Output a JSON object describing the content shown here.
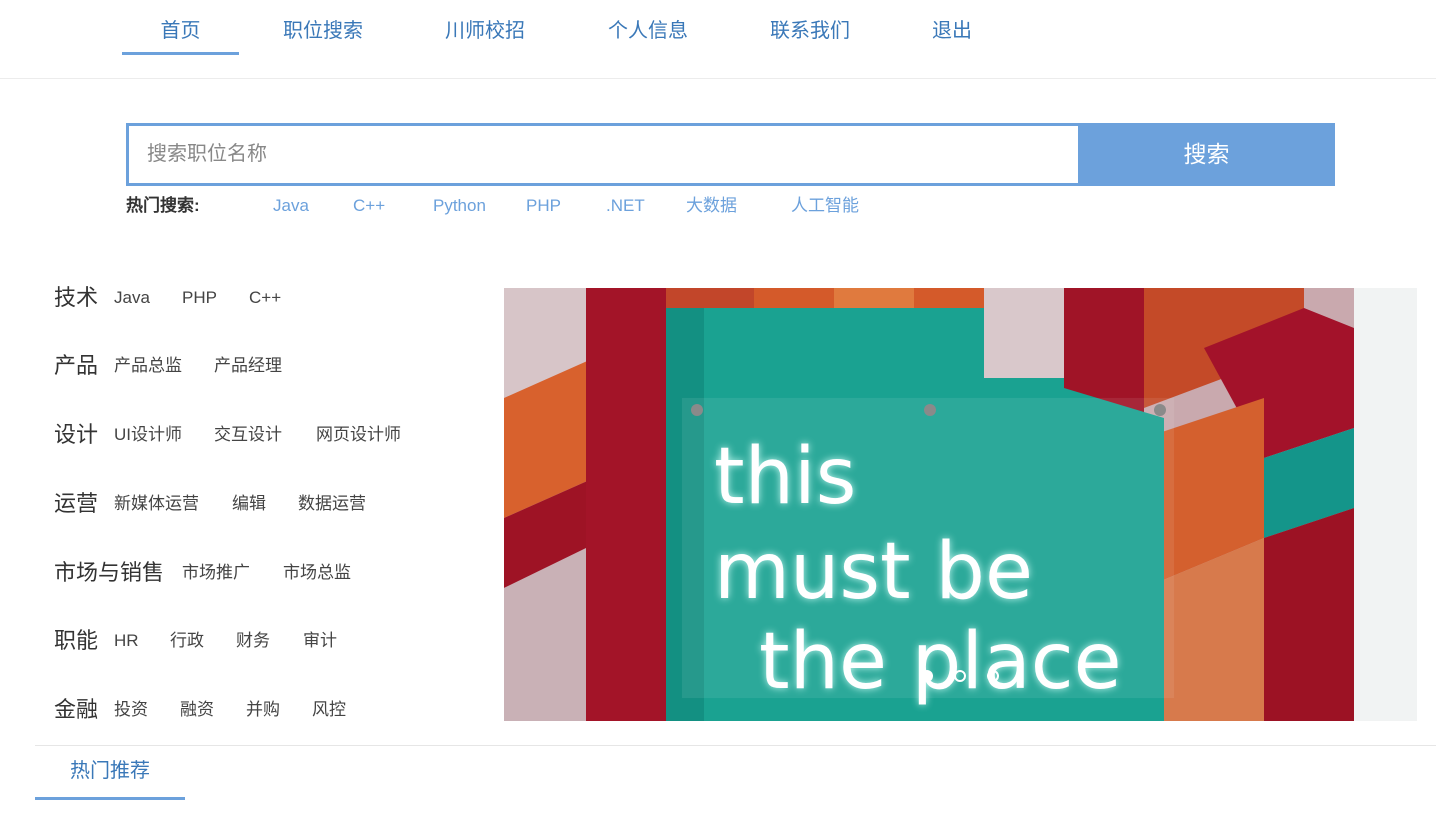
{
  "nav": {
    "items": [
      {
        "label": "首页",
        "active": true
      },
      {
        "label": "职位搜索"
      },
      {
        "label": "川师校招"
      },
      {
        "label": "个人信息"
      },
      {
        "label": "联系我们"
      },
      {
        "label": "退出"
      }
    ]
  },
  "search": {
    "placeholder": "搜索职位名称",
    "value": "",
    "button_label": "搜索",
    "hot_label": "热门搜索:",
    "hot_terms": [
      "Java",
      "C++",
      "Python",
      "PHP",
      ".NET",
      "大数据",
      "人工智能"
    ]
  },
  "categories": [
    {
      "title": "技术",
      "links": [
        "Java",
        "PHP",
        "C++"
      ]
    },
    {
      "title": "产品",
      "links": [
        "产品总监",
        "产品经理"
      ]
    },
    {
      "title": "设计",
      "links": [
        "UI设计师",
        "交互设计",
        "网页设计师"
      ]
    },
    {
      "title": "运营",
      "links": [
        "新媒体运营",
        "编辑",
        "数据运营"
      ]
    },
    {
      "title": "市场与销售",
      "links": [
        "市场推广",
        "市场总监"
      ]
    },
    {
      "title": "职能",
      "links": [
        "HR",
        "行政",
        "财务",
        "审计"
      ]
    },
    {
      "title": "金融",
      "links": [
        "投资",
        "融资",
        "并购",
        "风控"
      ]
    }
  ],
  "carousel": {
    "neon_lines": [
      "this",
      "must be",
      "the place"
    ],
    "dots": 3,
    "active_dot": 0
  },
  "section": {
    "tab_label": "热门推荐"
  },
  "colors": {
    "accent": "#6ca1dc",
    "nav_text": "#3a78b8",
    "neon_teal": "#1aa291",
    "wall_red": "#a31428",
    "wall_orange": "#d8612d",
    "wall_pink": "#d9c2c6"
  }
}
